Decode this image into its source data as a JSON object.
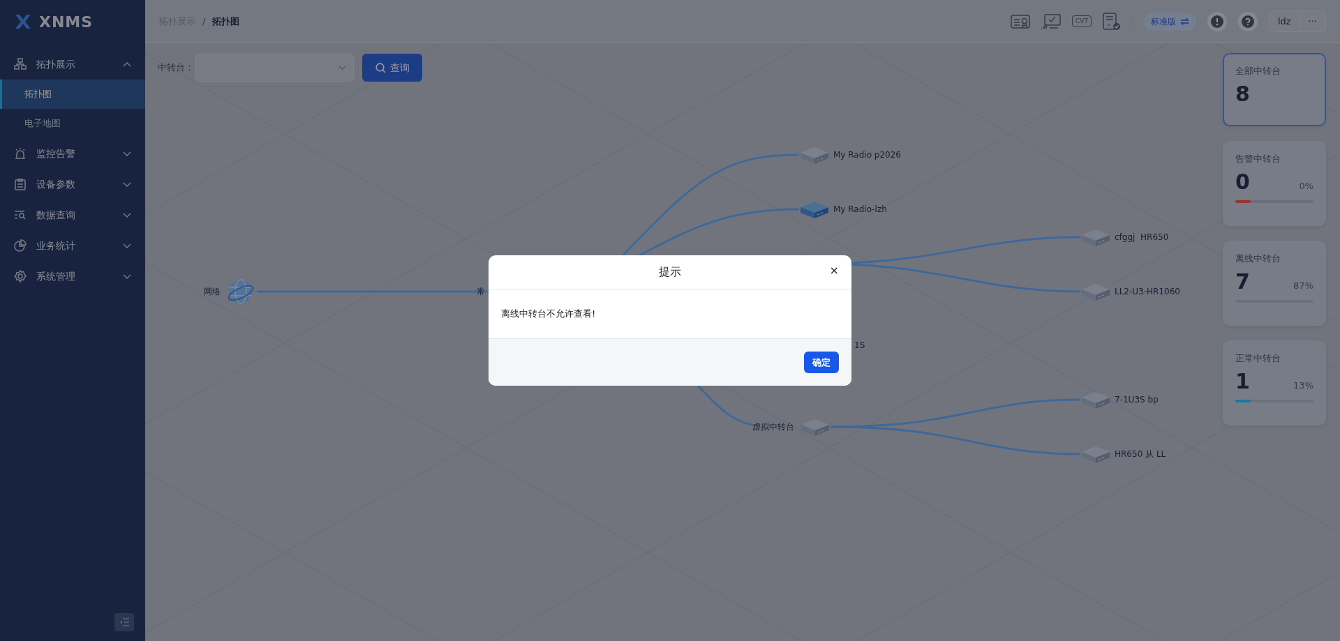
{
  "sidebar": {
    "logo": "XNMS",
    "menu": [
      {
        "label": "拓扑展示",
        "expanded": true,
        "children": [
          {
            "label": "拓扑图",
            "selected": true
          },
          {
            "label": "电子地图",
            "selected": false
          }
        ]
      },
      {
        "label": "监控告警",
        "expanded": false
      },
      {
        "label": "设备参数",
        "expanded": false
      },
      {
        "label": "数据查询",
        "expanded": false
      },
      {
        "label": "业务统计",
        "expanded": false
      },
      {
        "label": "系统管理",
        "expanded": false
      }
    ]
  },
  "header": {
    "breadcrumb": [
      "拓扑展示",
      "拓扑图"
    ],
    "separator": "/",
    "cvt": "CVT",
    "edition": "标准版",
    "user": "ldz",
    "more": "···"
  },
  "filter": {
    "label": "中转台：",
    "button": "查询"
  },
  "topology": {
    "nodes": [
      {
        "label": "网络",
        "kind": "globe"
      },
      {
        "label": "常",
        "kind": "text"
      },
      {
        "label": "My Radio p2026",
        "kind": "device",
        "online": false
      },
      {
        "label": "My Radio-lzh",
        "kind": "device",
        "online": true
      },
      {
        "label": "cfggj  HR650",
        "kind": "device",
        "online": false
      },
      {
        "label": "LL2-U3-HR1060",
        "kind": "device",
        "online": false
      },
      {
        "label": "1S",
        "kind": "text"
      },
      {
        "label": "虚拟中转台",
        "kind": "device",
        "online": false
      },
      {
        "label": "7-1U3S bp",
        "kind": "device",
        "online": false
      },
      {
        "label": "HR650 从 LL",
        "kind": "device",
        "online": false
      }
    ]
  },
  "stats": [
    {
      "title": "全部中转台",
      "count": "8",
      "selected": true
    },
    {
      "title": "告警中转台",
      "count": "0",
      "percent": "0%",
      "level": 0.2,
      "color": "#96382f",
      "selected": false
    },
    {
      "title": "离线中转台",
      "count": "7",
      "percent": "87%",
      "level": 0.2,
      "color": "#6e7078",
      "selected": false
    },
    {
      "title": "正常中转台",
      "count": "1",
      "percent": "13%",
      "level": 0.2,
      "color": "#1c7898",
      "selected": false
    }
  ],
  "dialog": {
    "title": "提示",
    "close": "×",
    "message": "离线中转台不允许查看!",
    "confirm": "确定"
  }
}
